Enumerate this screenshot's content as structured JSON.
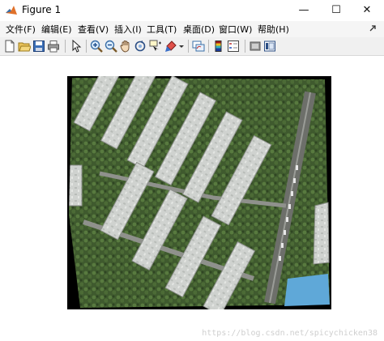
{
  "window": {
    "title": "Figure 1"
  },
  "controls": {
    "minimize": "—",
    "maximize": "☐",
    "close": "✕"
  },
  "menu": [
    "文件(F)",
    "编辑(E)",
    "查看(V)",
    "插入(I)",
    "工具(T)",
    "桌面(D)",
    "窗口(W)",
    "帮助(H)"
  ],
  "toolbar": {
    "icons": [
      "new-figure-icon",
      "open-file-icon",
      "save-icon",
      "print-icon",
      "pointer-icon",
      "zoom-in-icon",
      "zoom-out-icon",
      "pan-icon",
      "rotate-3d-icon",
      "data-cursor-icon",
      "brush-icon",
      "link-plot-icon",
      "colorbar-icon",
      "legend-icon",
      "hide-plot-tools-icon",
      "show-plot-tools-icon"
    ]
  },
  "image": {
    "description_id": "aerial-stitched-photo",
    "colors": {
      "vegetation": "#3f5a2e",
      "roof": "#cfd2cf",
      "water": "#5fa8d8"
    }
  },
  "watermark": "https://blog.csdn.net/spicychicken38"
}
